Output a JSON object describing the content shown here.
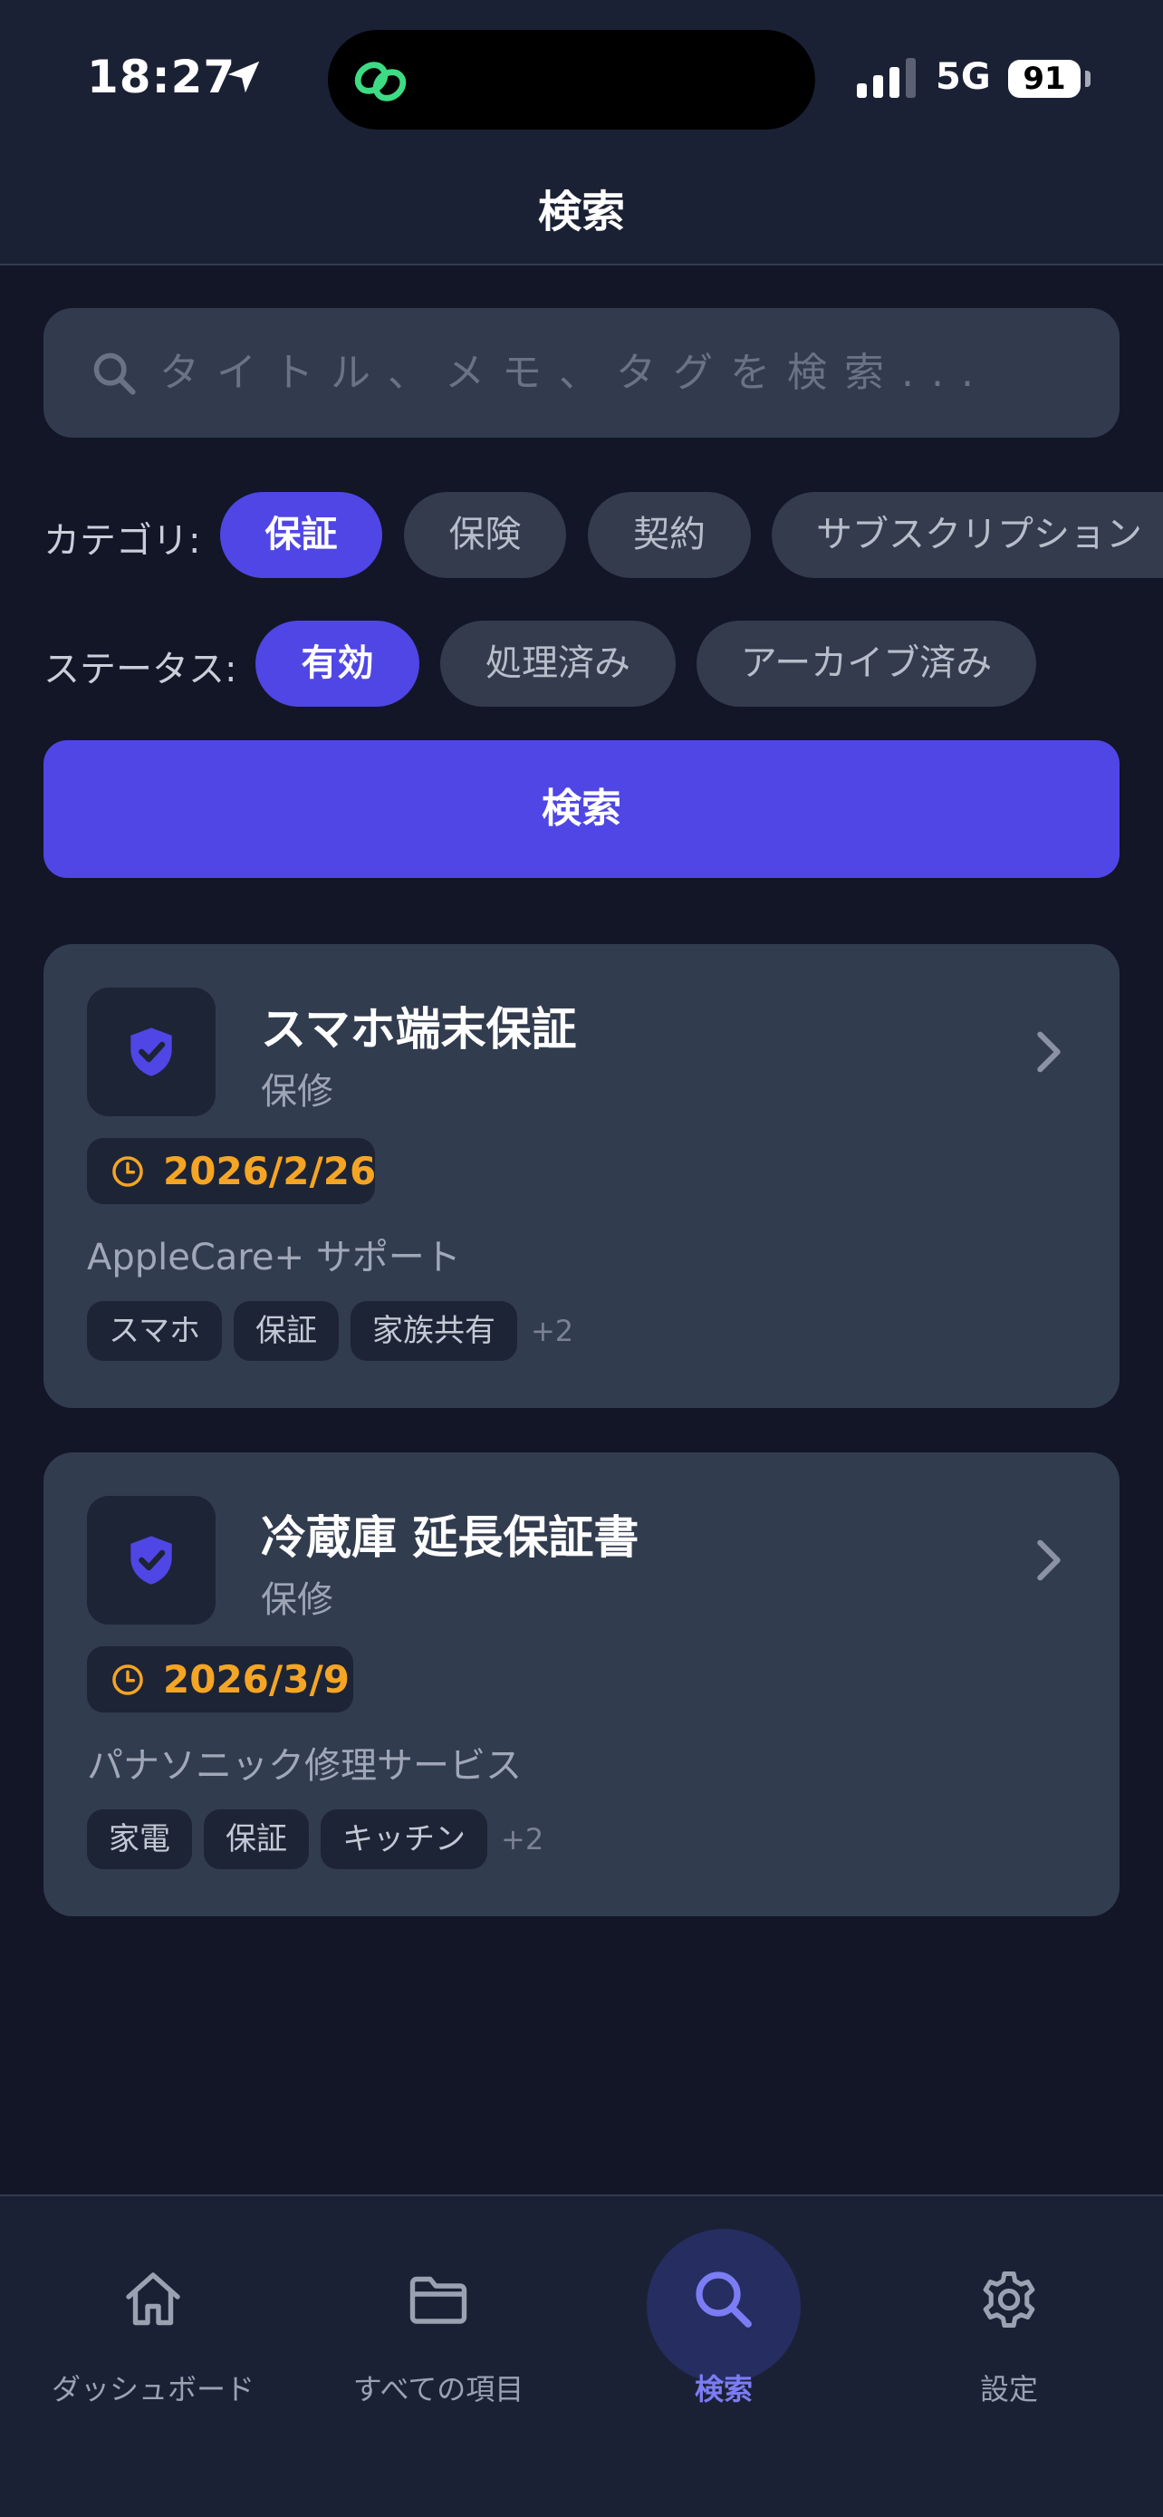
{
  "status_bar": {
    "time": "18:27",
    "network": "5G",
    "battery": "91"
  },
  "header": {
    "title": "検索"
  },
  "search": {
    "placeholder": "タイトル、メモ、タグを検索..."
  },
  "filters": {
    "category_label": "カテゴリ:",
    "categories": [
      {
        "label": "保証",
        "active": true
      },
      {
        "label": "保険",
        "active": false
      },
      {
        "label": "契約",
        "active": false
      },
      {
        "label": "サブスクリプション",
        "active": false
      }
    ],
    "status_label": "ステータス:",
    "statuses": [
      {
        "label": "有効",
        "active": true
      },
      {
        "label": "処理済み",
        "active": false
      },
      {
        "label": "アーカイブ済み",
        "active": false
      }
    ]
  },
  "search_button": "検索",
  "results": [
    {
      "title": "スマホ端末保証",
      "subtitle": "保修",
      "date": "2026/2/26",
      "note": "AppleCare+ サポート",
      "tags": [
        "スマホ",
        "保証",
        "家族共有"
      ],
      "more": "+2"
    },
    {
      "title": "冷蔵庫 延長保証書",
      "subtitle": "保修",
      "date": "2026/3/9",
      "note": "パナソニック修理サービス",
      "tags": [
        "家電",
        "保証",
        "キッチン"
      ],
      "more": "+2"
    }
  ],
  "tabbar": {
    "items": [
      {
        "label": "ダッシュボード",
        "icon": "home-icon"
      },
      {
        "label": "すべての項目",
        "icon": "folder-icon"
      },
      {
        "label": "検索",
        "icon": "search-icon",
        "active": true
      },
      {
        "label": "設定",
        "icon": "gear-icon"
      }
    ]
  },
  "colors": {
    "accent": "#4f46e5",
    "background": "#121627",
    "card": "#323c4f",
    "date": "#f5a524"
  }
}
